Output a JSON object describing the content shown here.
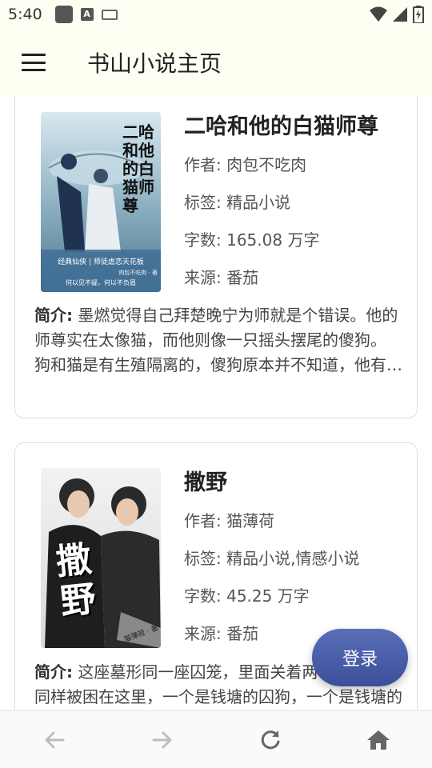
{
  "status_bar": {
    "time": "5:40",
    "icons": [
      "app-notification-icon",
      "a-badge-icon",
      "keyboard-icon",
      "wifi-icon",
      "signal-icon",
      "battery-icon"
    ]
  },
  "header": {
    "menu_icon": "hamburger-menu-icon",
    "title": "书山小说主页"
  },
  "books": [
    {
      "title": "二哈和他的白猫师尊",
      "author_label": "作者: ",
      "author": "肉包不吃肉",
      "tags_label": "标签: ",
      "tags": "精品小说",
      "words_label": "字数: ",
      "words": "165.08 万字",
      "source_label": "来源: ",
      "source": "番茄",
      "summary_label": "简介:",
      "summary": " 墨燃觉得自己拜楚晚宁为师就是个错误。他的师尊实在太像猫，而他则像一只摇头摆尾的傻狗。 狗和猫是有生殖隔离的，傻狗原本并不知道，他有朝一日会对一只白猫动心。",
      "cover": {
        "title_art": "二哈和他的白猫师尊",
        "banner": "经典仙侠 | 师徒虐恋天花板",
        "sub": "肉包不吃肉 · 著",
        "line": "何以见不疑，何以不负眉"
      }
    },
    {
      "title": "撒野",
      "author_label": "作者: ",
      "author": "猫薄荷",
      "tags_label": "标签: ",
      "tags": "精品小说,情感小说",
      "words_label": "字数: ",
      "words": "45.25 万字",
      "source_label": "来源: ",
      "source": "番茄",
      "summary_label": "简介:",
      "summary": " 这座墓形同一座囚笼，里面关着两个人。他们同样被困在这里，一个是钱塘的囚狗，一个是钱塘的猫痞。",
      "cover": {
        "title_art": "撒野",
        "sub": "猫薄荷 · 著"
      }
    }
  ],
  "fab": {
    "label": "登录"
  },
  "bottom_nav": {
    "items": [
      "back-arrow-icon",
      "forward-arrow-icon",
      "refresh-icon",
      "home-icon"
    ]
  },
  "colors": {
    "header_bg": "#fefef2",
    "fab_gradient_top": "#5a6fb8",
    "fab_gradient_bottom": "#3b4e9a",
    "card_border": "#dcdcdc"
  }
}
